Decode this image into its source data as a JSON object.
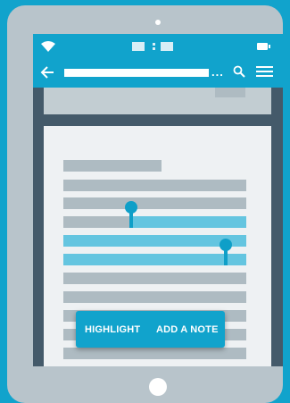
{
  "colors": {
    "background": "#11a3cc",
    "device_frame": "#b8c4cb",
    "screen_border": "#445a6a",
    "app_bar": "#11a3cc",
    "page": "#eef1f3",
    "text_placeholder": "#aebbc2",
    "selection": "#64c5e0",
    "selection_handle": "#0f9fc8",
    "context_menu": "#11a3cc"
  },
  "status_bar": {
    "icons": [
      "wifi-icon",
      "battery-icon"
    ]
  },
  "toolbar": {
    "ellipsis": "...",
    "icons": [
      "back-arrow-icon",
      "search-icon",
      "menu-icon"
    ]
  },
  "context_menu": {
    "highlight_label": "HIGHLIGHT",
    "note_label": "ADD A NOTE"
  }
}
